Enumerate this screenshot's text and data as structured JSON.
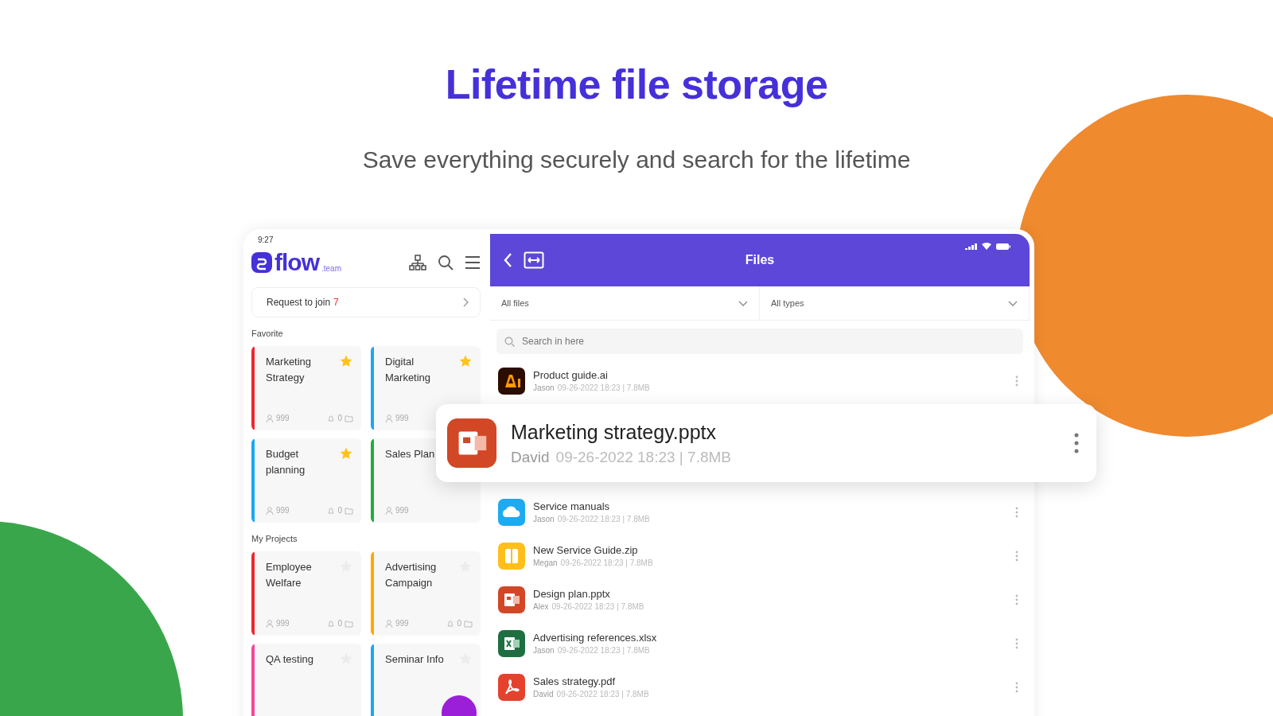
{
  "headline": "Lifetime file storage",
  "subtitle": "Save everything securely and search for the lifetime",
  "app": {
    "status_time": "9:27",
    "logo": "flow",
    "logo_suffix": ".team",
    "request": {
      "label": "Request to join",
      "count": "7"
    },
    "sections": [
      {
        "title": "Favorite",
        "projects": [
          {
            "name": "Marketing Strategy",
            "color": "#f0262e",
            "starred": true,
            "members": "999",
            "comments": "0"
          },
          {
            "name": "Digital Marketing",
            "color": "#1aa7f5",
            "starred": true,
            "members": "999"
          },
          {
            "name": "Budget planning",
            "color": "#1aa7f5",
            "starred": true,
            "members": "999",
            "comments": "0"
          },
          {
            "name": "Sales Plan",
            "color": "#1fae3b",
            "members": "999"
          }
        ]
      },
      {
        "title": "My Projects",
        "projects": [
          {
            "name": "Employee Welfare",
            "color": "#f0262e",
            "starred": false,
            "members": "999",
            "comments": "0"
          },
          {
            "name": "Advertising Campaign",
            "color": "#ffa800",
            "starred": false,
            "members": "999",
            "comments": "0"
          },
          {
            "name": "QA testing",
            "color": "#f5479a",
            "starred": false
          },
          {
            "name": "Seminar Info",
            "color": "#1aa7f5",
            "starred": false
          }
        ]
      }
    ]
  },
  "files_screen": {
    "title": "Files",
    "filters": [
      "All files",
      "All types"
    ],
    "search": {
      "placeholder": "Search in here"
    },
    "files": [
      {
        "kind": "ai",
        "name": "Product guide.ai",
        "owner": "Jason",
        "meta": "09-26-2022 18:23 | 7.8MB",
        "lifted": false
      },
      {
        "kind": "pptx",
        "name": "Marketing strategy.pptx",
        "owner": "David",
        "meta": "09-26-2022 18:23 | 7.8MB",
        "lifted": true
      },
      {
        "kind": "cloud",
        "name": "Service manuals",
        "owner": "Jason",
        "meta": "09-26-2022 18:23 | 7.8MB",
        "lifted": false
      },
      {
        "kind": "zip",
        "name": "New Service Guide.zip",
        "owner": "Megan",
        "meta": "09-26-2022 18:23 | 7.8MB",
        "lifted": false
      },
      {
        "kind": "pptx",
        "name": "Design plan.pptx",
        "owner": "Alex",
        "meta": "09-26-2022 18:23 | 7.8MB",
        "lifted": false
      },
      {
        "kind": "xlsx",
        "name": "Advertising references.xlsx",
        "owner": "Jason",
        "meta": "09-26-2022 18:23 | 7.8MB",
        "lifted": false
      },
      {
        "kind": "pdf",
        "name": "Sales strategy.pdf",
        "owner": "David",
        "meta": "09-26-2022 18:23 | 7.8MB",
        "lifted": false
      }
    ]
  }
}
